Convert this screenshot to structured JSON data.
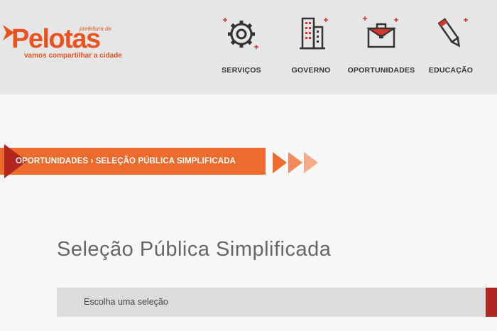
{
  "header": {
    "logo": {
      "prefix": "prefeitura de",
      "name": "Pelotas",
      "tagline": "vamos compartilhar a cidade"
    },
    "nav": [
      {
        "label": "SERVIÇOS",
        "icon": "gear-icon"
      },
      {
        "label": "GOVERNO",
        "icon": "buildings-icon"
      },
      {
        "label": "OPORTUNIDADES",
        "icon": "briefcase-icon"
      },
      {
        "label": "EDUCAÇÃO",
        "icon": "pencil-icon"
      }
    ]
  },
  "breadcrumb": {
    "text": "OPORTUNIDADES › SELEÇÃO PÚBLICA SIMPLIFICADA"
  },
  "main": {
    "title": "Seleção Pública Simplificada",
    "select": {
      "value": "Escolha uma seleção"
    }
  },
  "colors": {
    "brand_orange": "#e8531f",
    "breadcrumb_orange": "#ec6b2d",
    "dark_red": "#b32620",
    "header_bg": "#e6e6e6"
  }
}
